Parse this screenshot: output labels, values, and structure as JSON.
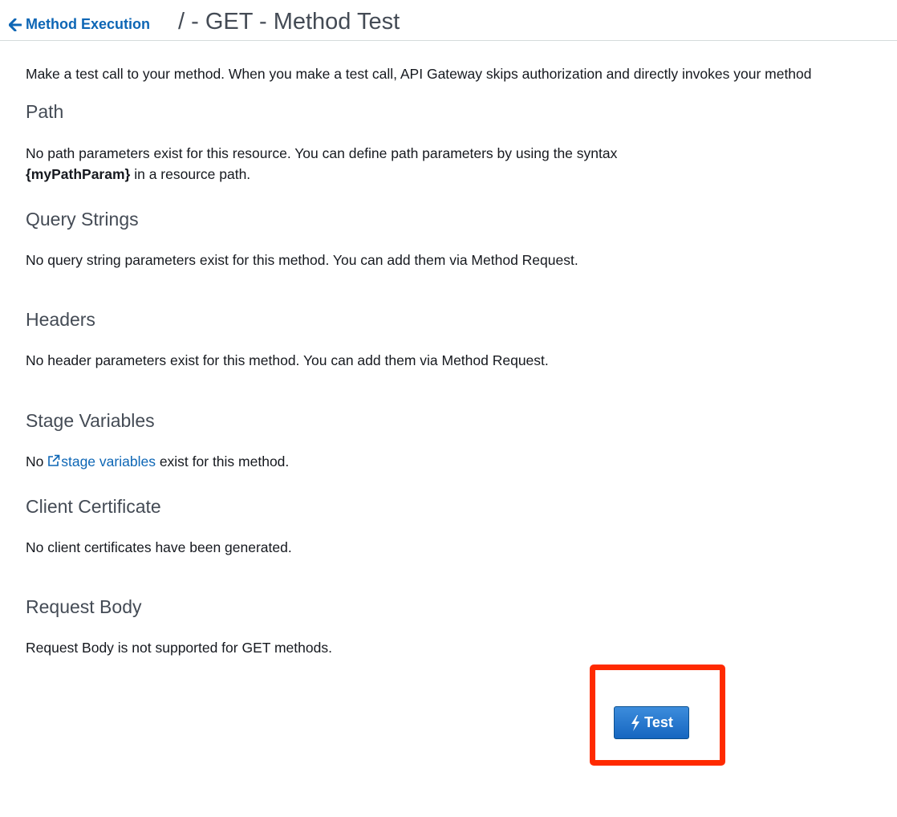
{
  "header": {
    "back_link": "Method Execution",
    "title": "/ - GET - Method Test"
  },
  "intro": "Make a test call to your method. When you make a test call, API Gateway skips authorization and directly invokes your method",
  "sections": {
    "path": {
      "title": "Path",
      "text_line1": "No path parameters exist for this resource. You can define path parameters by using the syntax",
      "param_syntax": "{myPathParam}",
      "text_line2_suffix": " in a resource path."
    },
    "query_strings": {
      "title": "Query Strings",
      "text": "No query string parameters exist for this method. You can add them via Method Request."
    },
    "headers": {
      "title": "Headers",
      "text": "No header parameters exist for this method. You can add them via Method Request."
    },
    "stage_variables": {
      "title": "Stage Variables",
      "prefix": "No ",
      "link": "stage variables",
      "suffix": " exist for this method."
    },
    "client_certificate": {
      "title": "Client Certificate",
      "text": "No client certificates have been generated."
    },
    "request_body": {
      "title": "Request Body",
      "text": "Request Body is not supported for GET methods."
    }
  },
  "actions": {
    "test_label": "Test"
  },
  "colors": {
    "link": "#0d66b5",
    "highlight": "#ff2a00",
    "button": "#1a6fc9"
  },
  "icons": {
    "back": "arrow-left-icon",
    "external": "external-link-icon",
    "test": "lightning-bolt-icon"
  }
}
